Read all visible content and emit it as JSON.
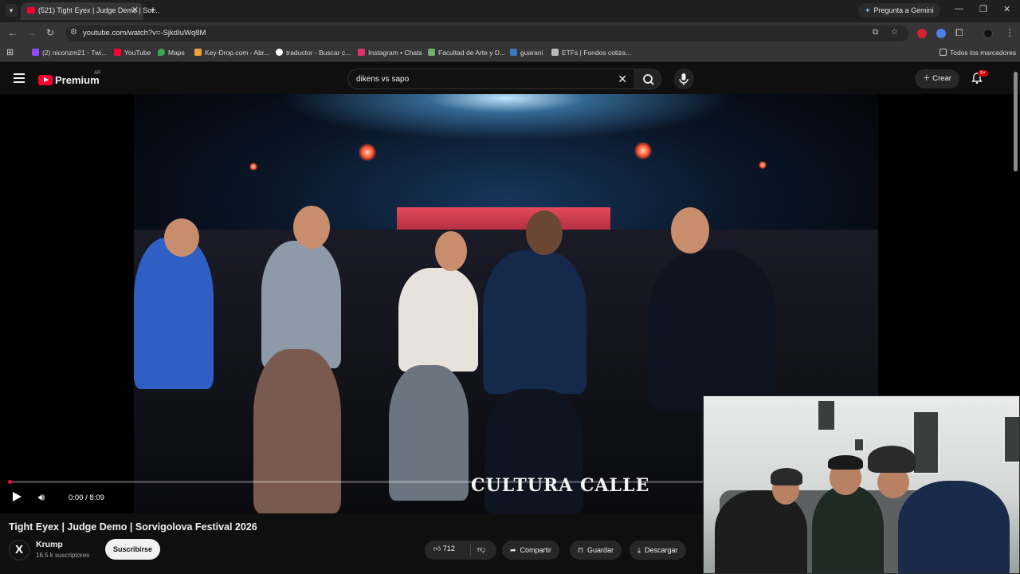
{
  "browser": {
    "tab_title": "(521) Tight Eyex | Judge Demo | Sor...",
    "gemini_label": "Pregunta a Gemini",
    "url": "youtube.com/watch?v=-SjkdIuWq8M",
    "bookmarks": [
      "(2) niconzm21 - Twi...",
      "YouTube",
      "Maps",
      "Key-Drop.com - Abr...",
      "traductor - Buscar c...",
      "Instagram • Chats",
      "Facultad de Arte y D...",
      "guarani",
      "ETFs | Fondos cotiza..."
    ],
    "all_bookmarks": "Todos los marcadores"
  },
  "youtube": {
    "brand": "Premium",
    "country": "AR",
    "search_value": "dikens vs sapo",
    "create_label": "Crear",
    "notif_badge": "9+"
  },
  "player": {
    "time": "0:00 / 8:09",
    "progress_fraction": 0.0,
    "watermark": "CULTURA CALLE"
  },
  "video": {
    "title": "Tight Eyex | Judge Demo | Sorvigolova Festival 2026",
    "channel_initial": "X",
    "channel_name": "Krump",
    "subscribers": "16.5 k suscriptores",
    "subscribe_label": "Suscribirse",
    "likes": "712",
    "share_label": "Compartir",
    "save_label": "Guardar",
    "download_label": "Descargar"
  },
  "colors": {
    "accent": "#ff0033",
    "background": "#0f0f0f"
  }
}
